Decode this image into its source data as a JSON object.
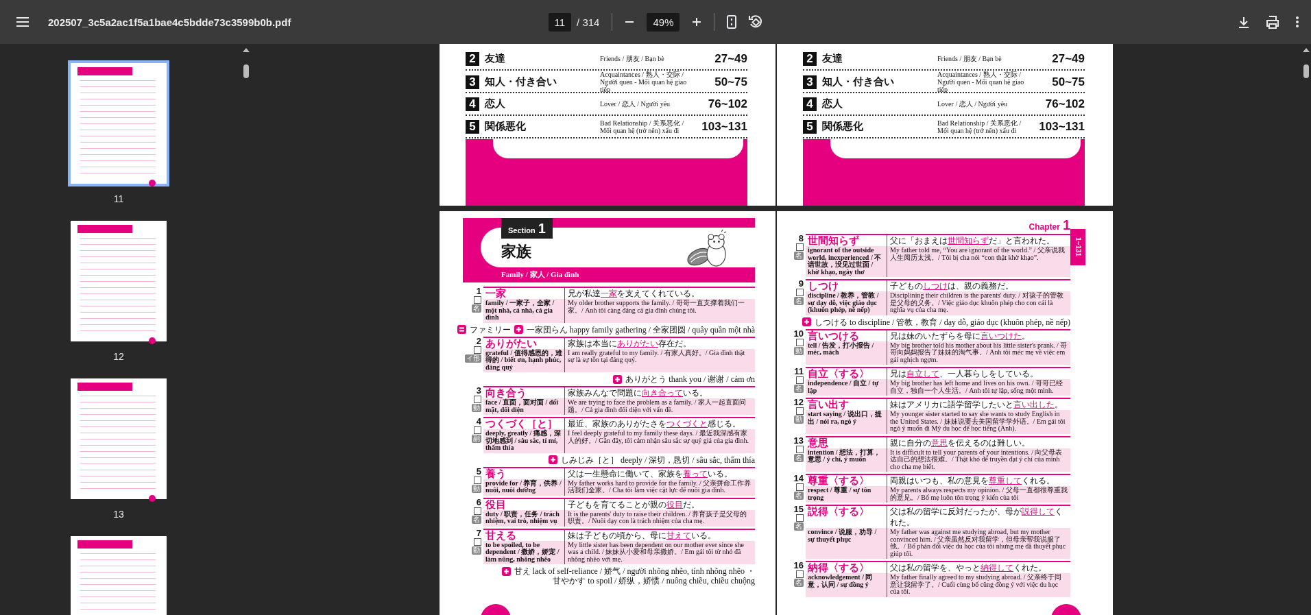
{
  "toolbar": {
    "file_name": "202507_3c5a2ac1f5a1bae4c5bdde73c3599b0b.pdf",
    "page_number": "11",
    "page_total": "/ 314",
    "zoom": "49%"
  },
  "thumbnails": [
    {
      "label": "11",
      "selected": true
    },
    {
      "label": "12",
      "selected": false
    },
    {
      "label": "13",
      "selected": false
    },
    {
      "selected": false
    }
  ],
  "top_spread": [
    {
      "rows": [
        {
          "number": "2",
          "title": "友達",
          "description": "Friends / 朋友 / Bạn bè",
          "range": "27~49"
        },
        {
          "number": "3",
          "title": "知人・付き合い",
          "description": "Acquaintances / 熟人・交际 / Người quen - Mối quan hệ giao tiếp",
          "range": "50~75"
        },
        {
          "number": "4",
          "title": "恋人",
          "description": "Lover / 恋人 / Người yêu",
          "range": "76~102"
        },
        {
          "number": "5",
          "title": "関係悪化",
          "description": "Bad Relationship / 关系恶化 / Mối quan hệ (trở nên) xấu đi",
          "range": "103~131"
        }
      ]
    },
    {
      "rows": [
        {
          "number": "2",
          "title": "友達",
          "description": "Friends / 朋友 / Bạn bè",
          "range": "27~49"
        },
        {
          "number": "3",
          "title": "知人・付き合い",
          "description": "Acquaintances / 熟人・交际 / Người quen - Mối quan hệ giao tiếp",
          "range": "50~75"
        },
        {
          "number": "4",
          "title": "恋人",
          "description": "Lover / 恋人 / Người yêu",
          "range": "76~102"
        },
        {
          "number": "5",
          "title": "関係悪化",
          "description": "Bad Relationship / 关系恶化 / Mối quan hệ (trở nên) xấu đi",
          "range": "103~131"
        }
      ]
    }
  ],
  "bottom_spread": [
    {
      "header": {
        "kind": "section",
        "label": "Section",
        "number": "1",
        "title": "家族",
        "subtitle": "Family / 家人 / Gia đình"
      },
      "entries": [
        {
          "number": "1",
          "title": "一家",
          "pos": "名",
          "sentence": "兄が私達**一家**を支えてくれている。",
          "sense": "family / 一家子，全家 / một nhà, cả nhà, cả gia đình",
          "translation": "My older brother supports the family. / 哥哥一直支撑着我们一家。/ Anh tôi càng đáng cả gia đình chúng tôi.",
          "extras": [
            [
              {
                "kind": "synonym",
                "text": "ファミリー"
              },
              {
                "kind": "related",
                "text": "一家団らん happy family gathering / 全家团圆 / quây quần một nhà"
              }
            ]
          ]
        },
        {
          "number": "2",
          "title": "ありがたい",
          "pos": "イ形",
          "sentence": "家族は本当に**ありがたい**存在だ。",
          "sense": "grateful / 值得感恩的，难得的 / biết ơn, hạnh phúc, đáng quý",
          "translation": "I am really grateful to my family. / 有家人真好。/ Gia đình thật sự là sự tồn tại đáng quý.",
          "extras": [
            [
              {
                "kind": "related",
                "text": "ありがとう thank you / 谢谢 / cảm ơn"
              }
            ]
          ]
        },
        {
          "number": "3",
          "title": "向き合う",
          "pos": "動",
          "sentence": "家族みんなで問題に**向き合って**いる。",
          "sense": "face / 直面，面对面 / đối mặt, đối diện",
          "translation": "We are trying to face the problem as a family. / 家人一起直面问题。/ Cả gia đình đối diện với vấn đề."
        },
        {
          "number": "4",
          "title": "つくづく［と］",
          "pos": "副",
          "sentence": "最近、家族のありがたさを**つくづくと**感じる。",
          "sense": "deeply, greatly / 痛感，深切地感到 / sâu sắc, tỉ mỉ, thấm thía",
          "translation": "I feel deeply grateful to my family these days. / 最近我深感有家人的好。/ Gần đây, tôi cảm nhận sâu sắc sự quý giá của gia đình.",
          "extras": [
            [
              {
                "kind": "related",
                "text": "しみじみ［と］ deeply / 深切，恳切 / sâu sắc, thấm thía"
              }
            ]
          ]
        },
        {
          "number": "5",
          "title": "養う",
          "pos": "動",
          "sentence": "父は一生懸命に働いて、家族を**養って**いる。",
          "sense": "provide for / 养育，供养 / nuôi, nuôi dưỡng",
          "translation": "My father works hard to provide for the family. / 父亲拼命工作养活我们全家。/ Cha tôi làm việc cật lực để nuôi gia đình."
        },
        {
          "number": "6",
          "title": "役目",
          "pos": "名",
          "sentence": "子どもを育てることが親の**役目**だ。",
          "sense": "duty / 职责，任务 / trách nhiệm, vai trò, nhiệm vụ",
          "translation": "It is the parents' duty to raise their children. / 养育孩子是父母的职责。/ Nuôi dạy con là trách nhiệm của cha mẹ."
        },
        {
          "number": "7",
          "title": "甘える",
          "pos": "動",
          "sentence": "妹は子どもの頃から、母に**甘えて**いる。",
          "sense": "to be spoiled, to be dependent / 撒娇，娇宠 / làm nũng, nhõng nhẽo",
          "translation": "My little sister has been dependent on our mother ever since she was a child. / 妹妹从小爱和母亲撒娇。/ Em gái tôi từ nhỏ đã nhõng nhẽo với mẹ.",
          "extras": [
            [
              {
                "kind": "related",
                "text": "甘え lack of self-reliance / 娇气 / người nhõng nhẽo, tính nhõng nhẽo ・"
              }
            ],
            [
              {
                "kind": "continued",
                "text": "甘やかす to spoil / 娇纵，娇惯 / nuông chiều, chiều chuộng"
              }
            ]
          ]
        }
      ]
    },
    {
      "header": {
        "kind": "chapter",
        "label": "Chapter",
        "number": "1",
        "side_tab": "1~131"
      },
      "entries": [
        {
          "number": "8",
          "title": "世間知らず",
          "pos": "名",
          "sentence": "父に「おまえは**世間知らず**だ」と言われた。",
          "sense": "ignorant of the outside world, inexperienced / 不谙世故，没见过世面 / khờ khạo, ngây thơ",
          "translation": "My father told me, “You are ignorant of the world.” / 父亲说我人生阅历太浅。/ Tôi bị cha nói “con thật khờ khạo”."
        },
        {
          "number": "9",
          "title": "しつけ",
          "pos": "名",
          "sentence": "子どもの**しつけ**は、親の義務だ。",
          "sense": "discipline / 教养，管教 / sự dạy dỗ, việc giáo dục (khuôn phép, nề nếp)",
          "translation": "Disciplining their children is the parents' duty. / 对孩子的管教是父母的义务。/ Việc giáo dục khuôn phép cho con cái là nghĩa vụ của cha mẹ.",
          "extras": [
            [
              {
                "kind": "related",
                "text": "しつける to discipline / 管教，教育 / dạy dỗ, giáo dục (khuôn phép, nề nếp)"
              }
            ]
          ]
        },
        {
          "number": "10",
          "title": "言いつける",
          "pos": "動",
          "sentence": "兄は妹のいたずらを母に**言いつけた**。",
          "sense": "tell / 告发，打小报告 / méc, mách",
          "translation": "My big brother told his mother about his little sister's prank. / 哥哥向妈妈报告了妹妹的淘气事。/ Anh tôi méc mẹ về việc em gái nghịch ngợm."
        },
        {
          "number": "11",
          "title": "自立〈する〉",
          "pos": "名",
          "sentence": "兄は**自立して**、一人暮らしをしている。",
          "sense": "independence / 自立 / tự lập",
          "translation": "My big brother has left home and lives on his own. / 哥哥已经自立，独自一个人生活。/ Anh tôi tự lập, sống một mình."
        },
        {
          "number": "12",
          "title": "言い出す",
          "pos": "動",
          "sentence": "妹はアメリカに語学留学したいと**言い出した**。",
          "sense": "start saying / 说出口，提出 / nói ra, ngỏ ý",
          "translation": "My younger sister started to say she wants to study English in the United States. / 妹妹说要去美国留学学外语。/ Em gái tôi ngỏ ý muốn đi Mỹ du học để học tiếng (Anh)."
        },
        {
          "number": "13",
          "title": "意思",
          "pos": "名",
          "sentence": "親に自分の**意思**を伝えるのは難しい。",
          "sense": "intention / 想法，打算，意思 / ý chí, ý muốn",
          "translation": "It is difficult to tell your parents of your intentions. / 向父母表达自己的想法很难。/ Thật khó để truyền đạt ý chí của mình cho cha mẹ biết."
        },
        {
          "number": "14",
          "title": "尊重〈する〉",
          "pos": "名",
          "sentence": "両親はいつも、私の意見を**尊重して**くれる。",
          "sense": "respect / 尊重 / sự tôn trọng",
          "translation": "My parents always respects my opinion. / 父母一直都很尊重我的意见。/ Bố mẹ luôn tôn trọng ý kiến của tôi"
        },
        {
          "number": "15",
          "title": "説得〈する〉",
          "pos": "名",
          "sentence": "父は私の留学に反対だったが、母が**説得して**くれた。",
          "sense": "convince / 说服，劝导 / sự thuyết phục",
          "translation": "My father was against me studying abroad, but my mother convinced him. / 父亲虽然反对我留学，但母亲帮我说服了他。/ Bố phản đối việc du học của tôi nhưng mẹ đã thuyết phục giúp tôi."
        },
        {
          "number": "16",
          "title": "納得〈する〉",
          "pos": "名",
          "sentence": "父は私の留学を、やっと**納得して**くれた。",
          "sense": "acknowledgement / 同意，认同 / sự đồng ý",
          "translation": "My father finally agreed to my studying abroad. / 父亲终于同意让我留学了。/ Cuối cùng bố cũng đồng ý với việc du học của tôi."
        }
      ]
    }
  ]
}
